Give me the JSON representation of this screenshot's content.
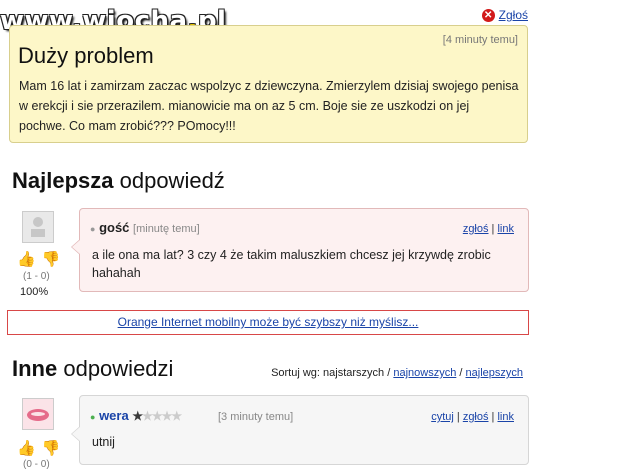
{
  "watermark": {
    "part1": "www.wiocha",
    "dot": ".",
    "part2": "pl"
  },
  "question": {
    "report_label": "Zgłoś",
    "time": "[4 minuty temu]",
    "title": "Duży problem",
    "body": "Mam 16 lat i zamirzam zaczac wspolzyc z dziewczyna. Zmierzylem dzisiaj swojego penisa w erekcji i sie przerazilem. mianowicie ma on az 5 cm. Boje sie ze uszkodzi on jej pochwe. Co mam zrobić??? POmocy!!!"
  },
  "best_answer": {
    "section_bold": "Najlepsza",
    "section_rest": " odpowiedź",
    "author": "gość",
    "time": "[minutę temu]",
    "links": [
      "zgłoś",
      "link"
    ],
    "text": "a ile ona ma lat? 3 czy 4 że takim maluszkiem chcesz jej krzywdę zrobic hahahah",
    "votes": "(1 - 0)",
    "percent": "100%"
  },
  "ad": {
    "text": "Orange Internet mobilny może być szybszy niż myślisz..."
  },
  "other_answers": {
    "section_bold": "Inne",
    "section_rest": " odpowiedzi",
    "sort_label": "Sortuj wg: najstarszych /",
    "sort_newest": "najnowszych",
    "sort_sep": "/",
    "sort_best": "najlepszych",
    "items": [
      {
        "author": "wera",
        "rating": 1,
        "rating_max": 5,
        "time": "[3 minuty temu]",
        "links": [
          "cytuj",
          "zgłoś",
          "link"
        ],
        "text": "utnij",
        "votes": "(0 - 0)"
      }
    ]
  },
  "colors": {
    "accent_link": "#1a44a8",
    "question_bg": "#fdf7c8",
    "answer_bg": "#fdf1f1"
  }
}
